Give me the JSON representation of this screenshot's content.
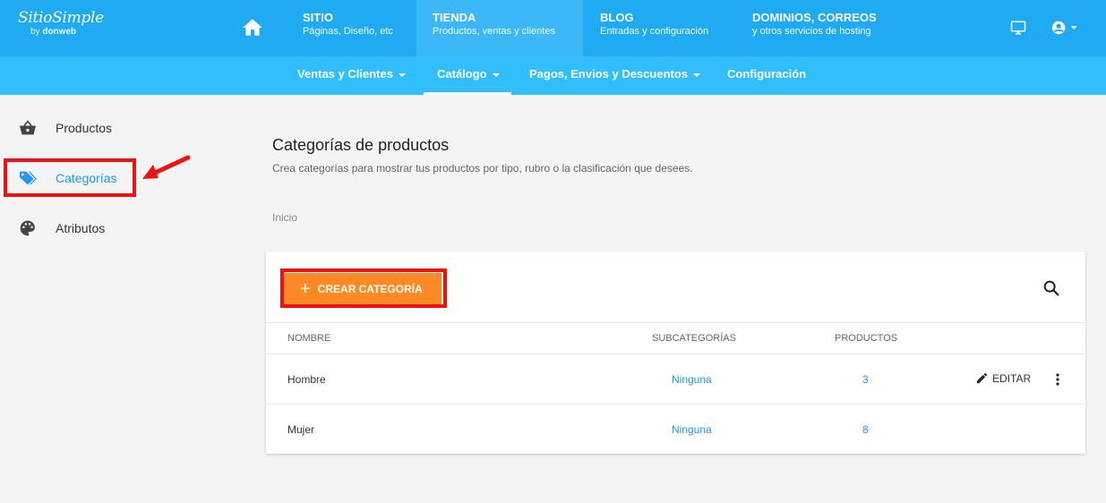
{
  "logo": {
    "main": "SitioSimple",
    "by": "by",
    "brand": "donweb"
  },
  "header": {
    "tabs": [
      {
        "title": "SITIO",
        "subtitle": "Páginas, Diseño, etc"
      },
      {
        "title": "TIENDA",
        "subtitle": "Productos, ventas y clientes"
      },
      {
        "title": "BLOG",
        "subtitle": "Entradas y configuración"
      },
      {
        "title": "DOMINIOS, CORREOS",
        "subtitle": "y otros servicios de hosting"
      }
    ],
    "icons": [
      "home-icon",
      "monitor-icon",
      "user-account-icon"
    ]
  },
  "subnav": {
    "items": [
      {
        "label": "Ventas y Clientes"
      },
      {
        "label": "Catálogo"
      },
      {
        "label": "Pagos, Envios y Descuentos"
      },
      {
        "label": "Configuración"
      }
    ]
  },
  "sidebar": {
    "items": [
      {
        "label": "Productos",
        "icon": "basket-icon"
      },
      {
        "label": "Categorías",
        "icon": "tags-icon"
      },
      {
        "label": "Atributos",
        "icon": "palette-icon"
      }
    ]
  },
  "main": {
    "title": "Categorías de productos",
    "description": "Crea categorías para mostrar tus productos por tipo, rubro o la clasificación que desees.",
    "breadcrumb": "Inicio",
    "create_button": "CREAR CATEGORÍA",
    "table": {
      "headers": [
        "NOMBRE",
        "SUBCATEGORÍAS",
        "PRODUCTOS"
      ],
      "rows": [
        {
          "name": "Hombre",
          "subcategories": "Ninguna",
          "products": "3"
        },
        {
          "name": "Mujer",
          "subcategories": "Ninguna",
          "products": "8"
        }
      ],
      "edit_label": "EDITAR"
    }
  },
  "colors": {
    "header": "#1faaf1",
    "subnav": "#32bdfc",
    "accent": "#2196f3",
    "create_button": "#ff8a25",
    "highlight": "#f01010"
  }
}
